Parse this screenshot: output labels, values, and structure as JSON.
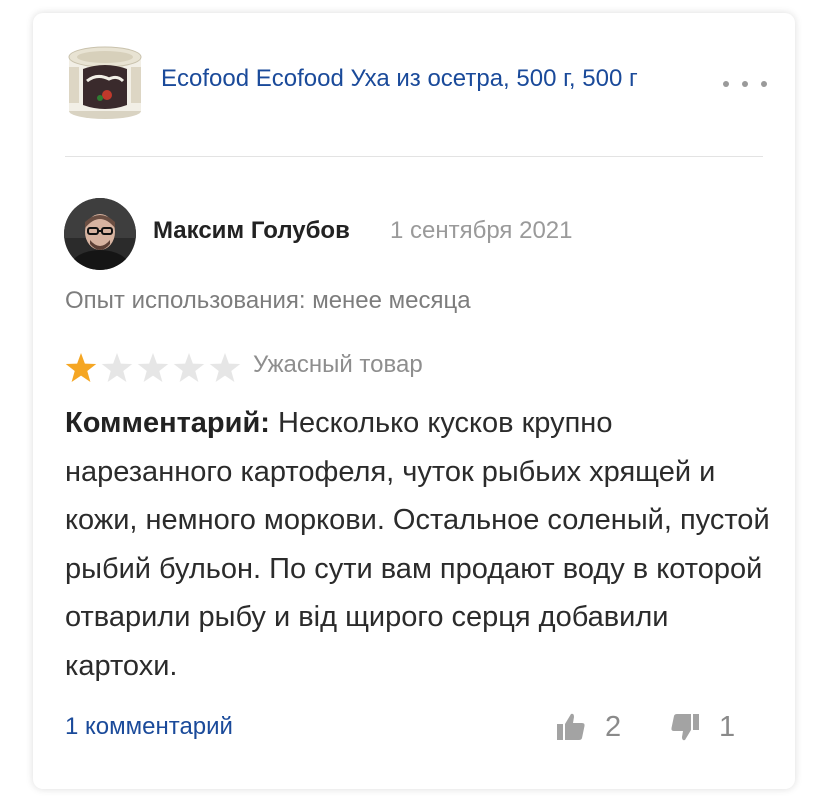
{
  "product": {
    "title": "Ecofood Ecofood Уха из осетра, 500 г, 500 г",
    "thumbnail_icon": "soup-can-image",
    "more_icon": "more-dots-icon"
  },
  "review": {
    "author": "Максим Голубов",
    "date": "1 сентября 2021",
    "experience": "Опыт использования: менее месяца",
    "rating": 1,
    "rating_max": 5,
    "rating_label": "Ужасный товар",
    "comment_label": "Комментарий:",
    "comment_text": " Несколько кусков крупно нарезанного картофеля, чуток рыбьих хрящей и кожи, немного моркови. Остальное соленый, пустой рыбий бульон. По сути вам продают воду в которой отварили рыбу и від щирого серця добавили картохи."
  },
  "footer": {
    "comments_link": "1 комментарий",
    "likes": "2",
    "dislikes": "1"
  },
  "colors": {
    "link": "#1a4a9a",
    "star_filled": "#f5a623",
    "star_empty": "#e6e6e6",
    "muted_text": "#9a9a9a"
  }
}
